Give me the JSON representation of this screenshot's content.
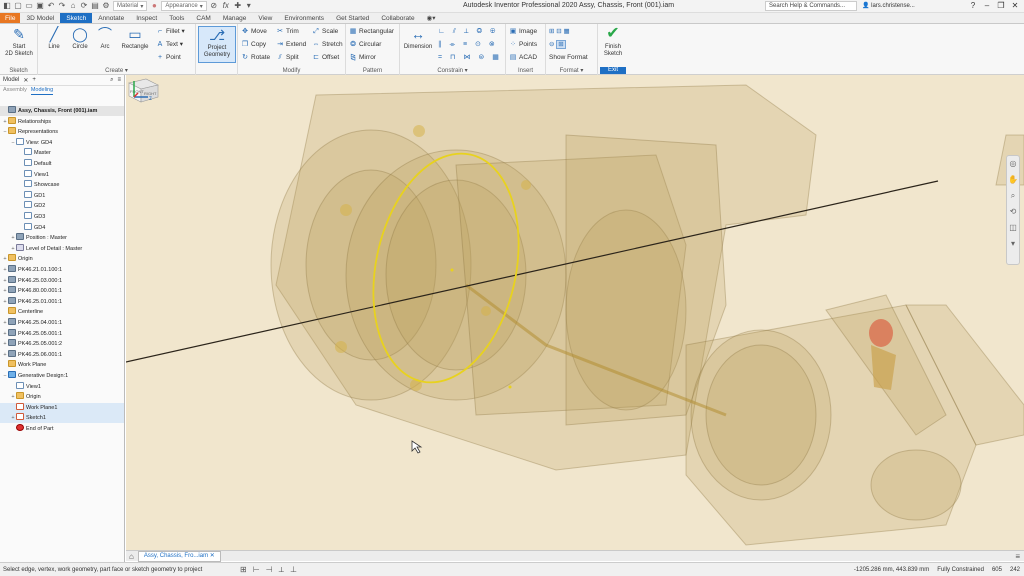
{
  "window_title": "Autodesk Inventor Professional 2020    Assy, Chassis, Front (001).iam",
  "quick_access": {
    "material_field": "Material",
    "appearance_field": "Appearance",
    "fx_label": "fx"
  },
  "search": {
    "placeholder": "Search Help & Commands..."
  },
  "user": {
    "name": "lars.christense..."
  },
  "ribbon_tabs": [
    "File",
    "3D Model",
    "Sketch",
    "Annotate",
    "Inspect",
    "Tools",
    "CAM",
    "Manage",
    "View",
    "Environments",
    "Get Started",
    "Collaborate"
  ],
  "ribbon": {
    "sketch": {
      "start_2d_sketch": "Start\n2D Sketch",
      "label": "Sketch"
    },
    "create": {
      "line": "Line",
      "circle": "Circle",
      "arc": "Arc",
      "rectangle": "Rectangle",
      "fillet": "Fillet",
      "text": "Text",
      "point": "Point",
      "label": "Create"
    },
    "project": {
      "project_geometry": "Project\nGeometry"
    },
    "modify": {
      "move": "Move",
      "trim": "Trim",
      "scale": "Scale",
      "copy": "Copy",
      "extend": "Extend",
      "stretch": "Stretch",
      "rotate": "Rotate",
      "split": "Split",
      "offset": "Offset",
      "label": "Modify"
    },
    "pattern": {
      "rectangular": "Rectangular",
      "circular": "Circular",
      "mirror": "Mirror",
      "label": "Pattern"
    },
    "constrain": {
      "dimension": "Dimension",
      "label": "Constrain"
    },
    "insert": {
      "image": "Image",
      "points": "Points",
      "acad": "ACAD",
      "label": "Insert"
    },
    "format": {
      "show_format": "Show Format",
      "label": "Format"
    },
    "exit": {
      "finish_sketch": "Finish\nSketch",
      "label": "Exit"
    }
  },
  "browser": {
    "title": "Model",
    "tabs": [
      "Assembly",
      "Modeling"
    ],
    "active_tab": "Modeling",
    "tree": [
      {
        "label": "Assy, Chassis, Front (001).iam",
        "bold": true
      },
      {
        "label": "Relationships"
      },
      {
        "label": "Representations"
      },
      {
        "label": "View: GD4"
      },
      {
        "label": "Master"
      },
      {
        "label": "Default"
      },
      {
        "label": "View1"
      },
      {
        "label": "Showcase"
      },
      {
        "label": "GD1"
      },
      {
        "label": "GD2"
      },
      {
        "label": "GD3"
      },
      {
        "label": "GD4"
      },
      {
        "label": "Position : Master"
      },
      {
        "label": "Level of Detail : Master"
      },
      {
        "label": "Origin"
      },
      {
        "label": "PK46.21.01.100:1"
      },
      {
        "label": "PK46.25.03.000:1"
      },
      {
        "label": "PK46.80.00.001:1"
      },
      {
        "label": "PK46.25.01.001:1"
      },
      {
        "label": "Centerline"
      },
      {
        "label": "PK46.25.04.001:1"
      },
      {
        "label": "PK46.25.05.001:1"
      },
      {
        "label": "PK46.25.05.001:2"
      },
      {
        "label": "PK46.25.06.001:1"
      },
      {
        "label": "Work Plane"
      },
      {
        "label": "Generative Design:1"
      },
      {
        "label": "View1"
      },
      {
        "label": "Origin"
      },
      {
        "label": "Work Plane1"
      },
      {
        "label": "Sketch1"
      },
      {
        "label": "End of Part"
      }
    ]
  },
  "viewcube": {
    "front": "FRONT",
    "right": "RIGHT"
  },
  "document_tab": "Assy, Chassis, Fro...iam",
  "status": {
    "prompt": "Select edge, vertex, work geometry, part face or sketch geometry to project",
    "coordinates": "-1205.286 mm, 443.839 mm",
    "constraint_status": "Fully Constrained",
    "count1": "605",
    "count2": "242"
  },
  "colors": {
    "accent": "#1e6fc4",
    "file_tab": "#e87722",
    "viewport_bg": "#f1e6cd",
    "sketch_ellipse": "#e8d21e"
  }
}
